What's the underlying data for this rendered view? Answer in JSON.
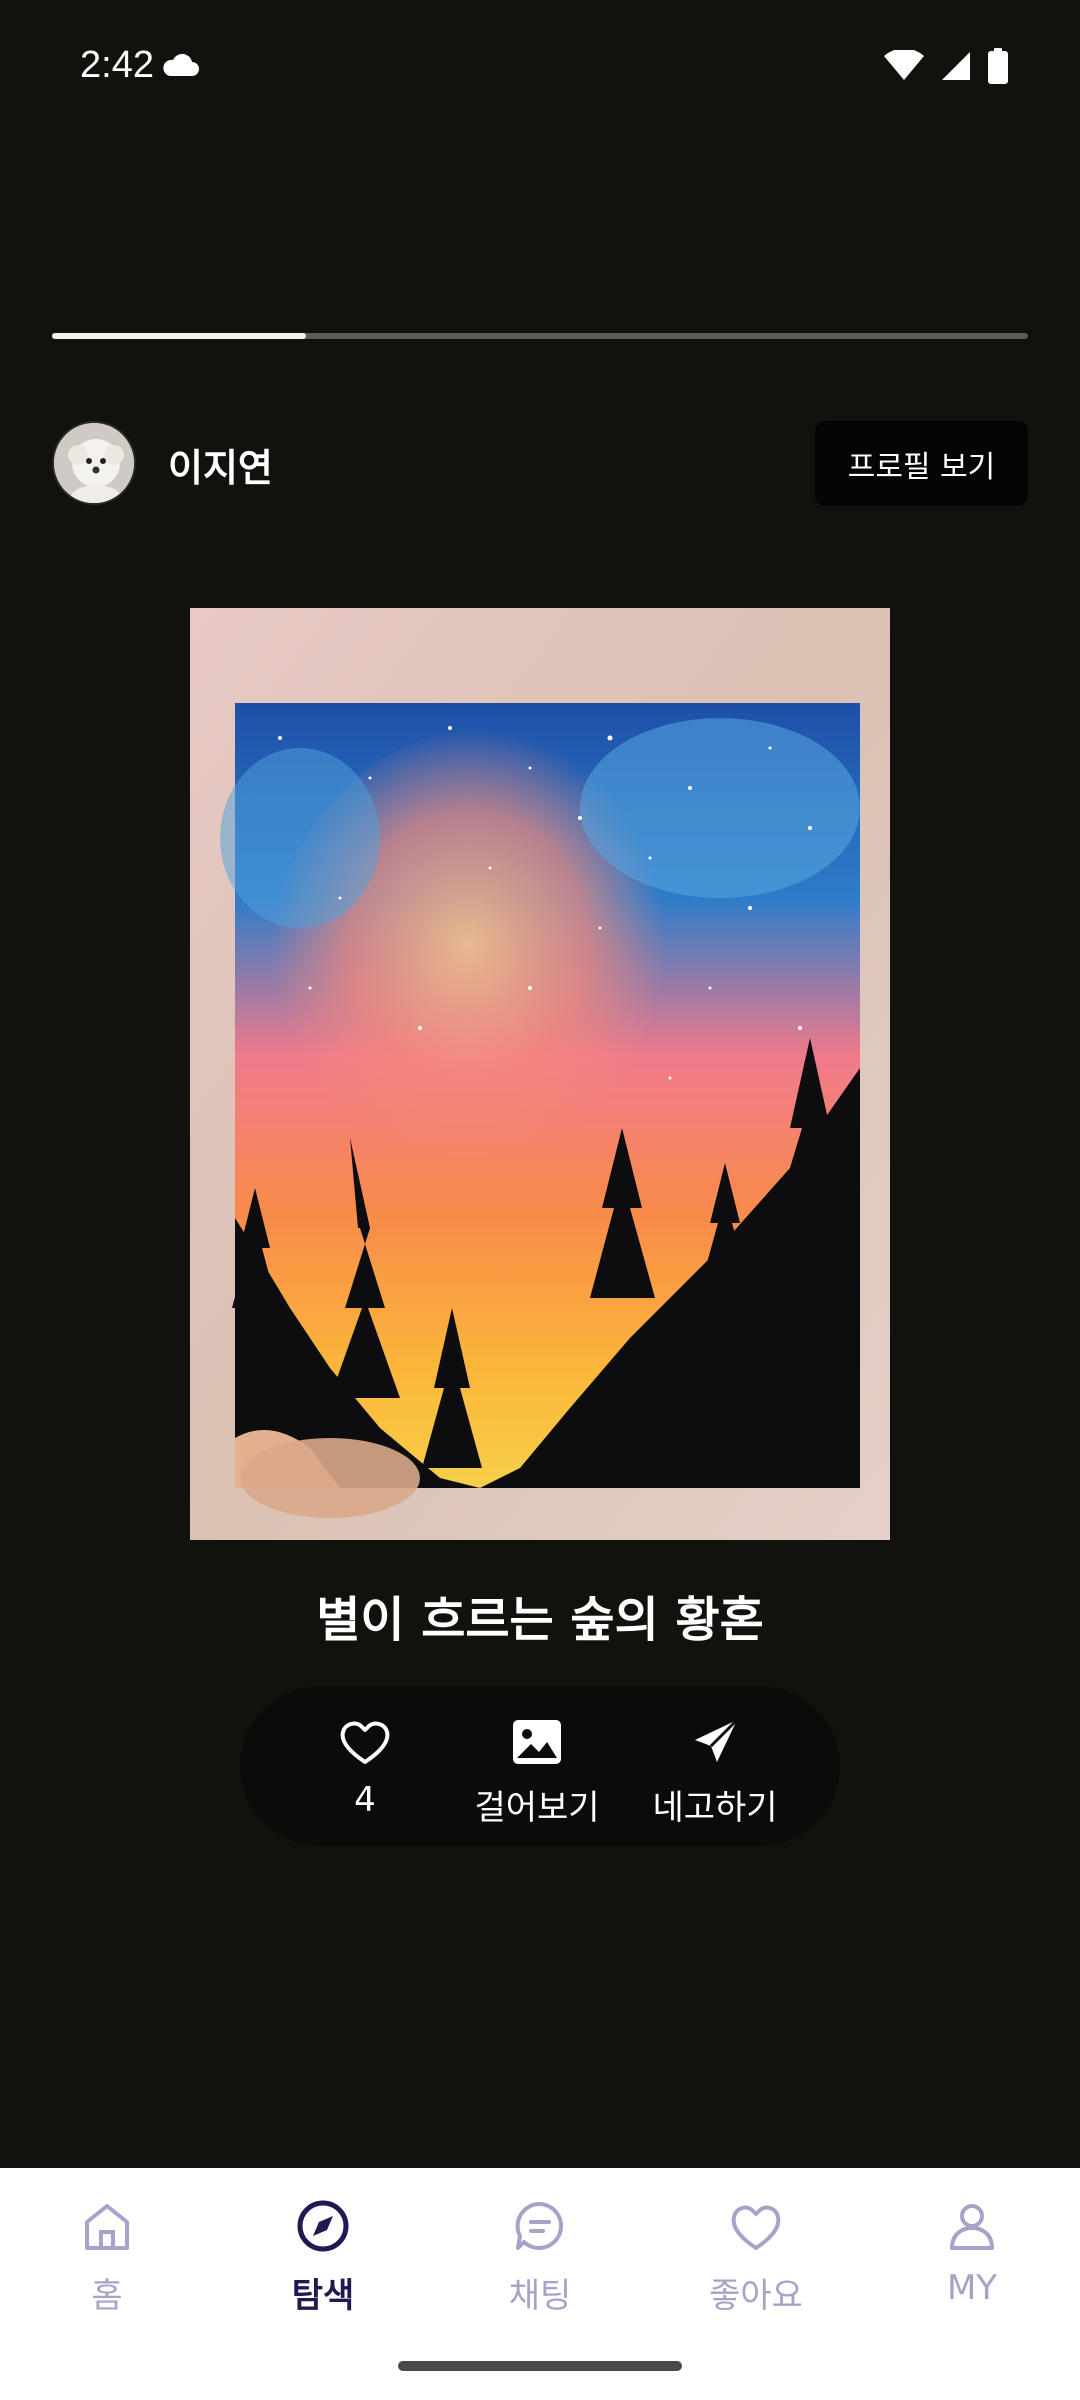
{
  "status_bar": {
    "time": "2:42",
    "weather_icon": "cloud-icon",
    "icons": [
      "wifi-icon",
      "signal-icon",
      "battery-icon"
    ]
  },
  "story_progress": 0.26,
  "author": {
    "name": "이지연",
    "profile_button": "프로필 보기"
  },
  "artwork": {
    "title": "별이 흐르는 숲의 황혼"
  },
  "actions": {
    "like_count": "4",
    "hang_label": "걸어보기",
    "share_label": "네고하기"
  },
  "nav": [
    {
      "label": "홈",
      "icon": "home-icon",
      "active": false
    },
    {
      "label": "탐색",
      "icon": "compass-icon",
      "active": true
    },
    {
      "label": "채팅",
      "icon": "chat-icon",
      "active": false
    },
    {
      "label": "좋아요",
      "icon": "heart-icon",
      "active": false
    },
    {
      "label": "MY",
      "icon": "person-icon",
      "active": false
    }
  ],
  "colors": {
    "background": "#11110d",
    "nav_active": "#1f1b52",
    "nav_inactive": "#a7a3c8"
  }
}
